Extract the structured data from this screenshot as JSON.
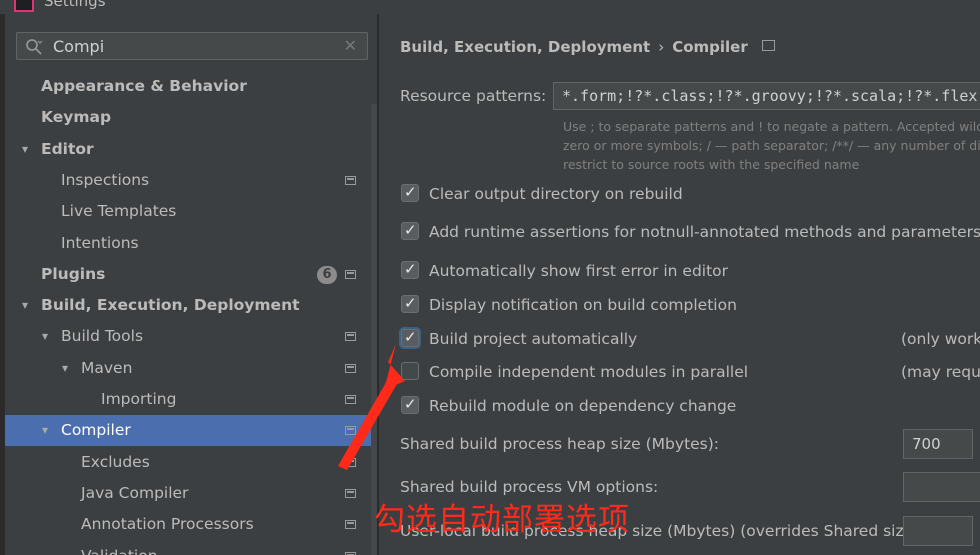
{
  "window": {
    "title": "Settings"
  },
  "search": {
    "value": "Compi",
    "clear": "✕"
  },
  "sidebar": {
    "items": [
      {
        "label": "Appearance & Behavior",
        "bold": true,
        "chev": "",
        "level": 0
      },
      {
        "label": "Keymap",
        "bold": true,
        "chev": "",
        "level": 0
      },
      {
        "label": "Editor",
        "bold": true,
        "chev": "▾",
        "level": 0
      },
      {
        "label": "Inspections",
        "bold": false,
        "chev": "",
        "level": 1,
        "proj": true
      },
      {
        "label": "Live Templates",
        "bold": false,
        "chev": "",
        "level": 1
      },
      {
        "label": "Intentions",
        "bold": false,
        "chev": "",
        "level": 1
      },
      {
        "label": "Plugins",
        "bold": true,
        "chev": "",
        "level": 0,
        "badge": "6",
        "proj": true
      },
      {
        "label": "Build, Execution, Deployment",
        "bold": true,
        "chev": "▾",
        "level": 0
      },
      {
        "label": "Build Tools",
        "bold": false,
        "chev": "▾",
        "level": 1,
        "proj": true
      },
      {
        "label": "Maven",
        "bold": false,
        "chev": "▾",
        "level": 2,
        "proj": true
      },
      {
        "label": "Importing",
        "bold": false,
        "chev": "",
        "level": 3,
        "proj": true
      },
      {
        "label": "Compiler",
        "bold": false,
        "chev": "▾",
        "level": 1,
        "proj": true,
        "selected": true
      },
      {
        "label": "Excludes",
        "bold": false,
        "chev": "",
        "level": 2,
        "proj": true
      },
      {
        "label": "Java Compiler",
        "bold": false,
        "chev": "",
        "level": 2,
        "proj": true
      },
      {
        "label": "Annotation Processors",
        "bold": false,
        "chev": "",
        "level": 2,
        "proj": true
      },
      {
        "label": "Validation",
        "bold": false,
        "chev": "",
        "level": 2,
        "proj": true
      }
    ]
  },
  "breadcrumb": {
    "parent": "Build, Execution, Deployment",
    "sep": "›",
    "current": "Compiler"
  },
  "resource": {
    "label": "Resource patterns:",
    "value": "*.form;!?*.class;!?*.groovy;!?*.scala;!?*.flex",
    "help": [
      "Use ; to separate patterns and ! to negate a pattern. Accepted wildc",
      "zero or more symbols; / — path separator; /**/ — any number of di",
      "restrict to source roots with the specified name"
    ]
  },
  "options": [
    {
      "label": "Clear output directory on rebuild",
      "checked": true
    },
    {
      "label": "Add runtime assertions for notnull-annotated methods and parameters",
      "checked": true,
      "button": true
    },
    {
      "label": "Automatically show first error in editor",
      "checked": true
    },
    {
      "label": "Display notification on build completion",
      "checked": true
    },
    {
      "label": "Build project automatically",
      "checked": true,
      "focused": true,
      "note": "(only works"
    },
    {
      "label": "Compile independent modules in parallel",
      "checked": false,
      "note": "(may requir"
    },
    {
      "label": "Rebuild module on dependency change",
      "checked": true
    }
  ],
  "heap": {
    "label": "Shared build process heap size (Mbytes):",
    "value": "700"
  },
  "vm": {
    "label": "Shared build process VM options:",
    "value": ""
  },
  "userheap": {
    "label": "User-local build process heap size (Mbytes) (overrides Shared size):",
    "value": ""
  },
  "annotation": {
    "text": "勾选自动部署选项",
    "color": "#ff2a1a"
  },
  "colors": {
    "selection": "#4b6eaf",
    "background": "#3c3f41"
  }
}
